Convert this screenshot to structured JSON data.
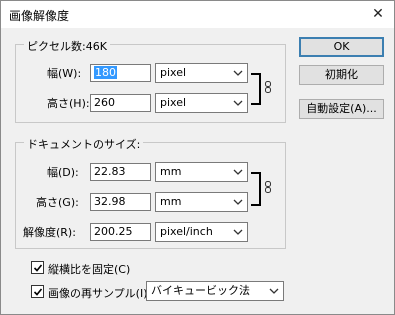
{
  "window": {
    "title": "画像解像度",
    "close_glyph": "✕"
  },
  "pixel_group": {
    "legend": "ピクセル数:46K",
    "width": {
      "label": "幅(W):",
      "value": "180",
      "unit": "pixel"
    },
    "height": {
      "label": "高さ(H):",
      "value": "260",
      "unit": "pixel"
    }
  },
  "doc_group": {
    "legend": "ドキュメントのサイズ:",
    "width": {
      "label": "幅(D):",
      "value": "22.83",
      "unit": "mm"
    },
    "height": {
      "label": "高さ(G):",
      "value": "32.98",
      "unit": "mm"
    },
    "resolution": {
      "label": "解像度(R):",
      "value": "200.25",
      "unit": "pixel/inch"
    }
  },
  "options": {
    "constrain": {
      "label": "縦横比を固定(C)",
      "checked": true
    },
    "resample": {
      "label": "画像の再サンプル(I):",
      "checked": true,
      "method": "バイキュービック法"
    }
  },
  "buttons": {
    "ok": "OK",
    "reset": "初期化",
    "auto": "自動設定(A)..."
  },
  "icons": [
    "close-icon",
    "link-icon",
    "chevron-down-icon",
    "checkmark-icon"
  ]
}
